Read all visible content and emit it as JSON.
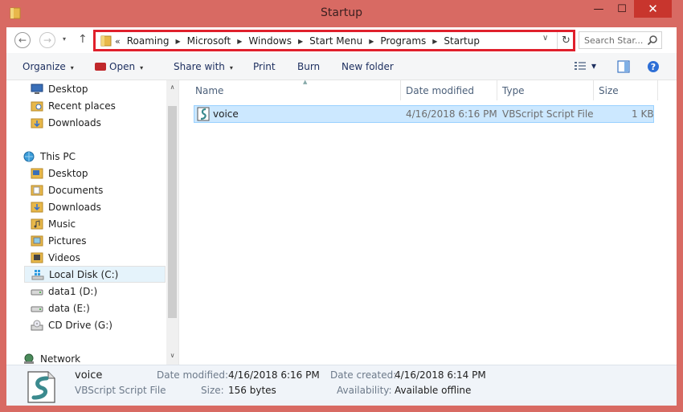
{
  "window": {
    "title": "Startup",
    "minimize": "—",
    "maximize": "☐",
    "close": "✕"
  },
  "nav": {
    "back": "←",
    "forward": "→",
    "recent": "▾",
    "up": "↑",
    "address_lead": "«",
    "breadcrumbs": [
      "Roaming",
      "Microsoft",
      "Windows",
      "Start Menu",
      "Programs",
      "Startup"
    ],
    "separator": "▶",
    "dropdown": "∨",
    "refresh": "↻",
    "search_placeholder": "Search Star..."
  },
  "toolbar": {
    "organize": "Organize",
    "open": "Open",
    "share_with": "Share with",
    "print": "Print",
    "burn": "Burn",
    "new_folder": "New folder",
    "caret": "▾"
  },
  "navpane": {
    "items": [
      {
        "label": "Desktop",
        "icon": "desktop-icon"
      },
      {
        "label": "Recent places",
        "icon": "recent-places-icon"
      },
      {
        "label": "Downloads",
        "icon": "downloads-folder-icon"
      },
      {
        "label": "This PC",
        "icon": "this-pc-icon"
      },
      {
        "label": "Desktop",
        "icon": "desktop-folder-icon"
      },
      {
        "label": "Documents",
        "icon": "documents-folder-icon"
      },
      {
        "label": "Downloads",
        "icon": "downloads-folder-icon"
      },
      {
        "label": "Music",
        "icon": "music-folder-icon"
      },
      {
        "label": "Pictures",
        "icon": "pictures-folder-icon"
      },
      {
        "label": "Videos",
        "icon": "videos-folder-icon"
      },
      {
        "label": "Local Disk (C:)",
        "icon": "windows-drive-icon"
      },
      {
        "label": "data1 (D:)",
        "icon": "drive-icon"
      },
      {
        "label": "data (E:)",
        "icon": "drive-icon"
      },
      {
        "label": "CD Drive (G:)",
        "icon": "cd-drive-icon"
      },
      {
        "label": "Network",
        "icon": "network-icon"
      }
    ],
    "scroll_up": "∧",
    "scroll_down": "∨"
  },
  "columns": {
    "name": "Name",
    "date_modified": "Date modified",
    "type": "Type",
    "size": "Size",
    "sort_indicator": "▲"
  },
  "files": [
    {
      "name": "voice",
      "date_modified": "4/16/2018 6:16 PM",
      "type": "VBScript Script File",
      "size": "1 KB"
    }
  ],
  "details": {
    "name": "voice",
    "type": "VBScript Script File",
    "date_modified_label": "Date modified:",
    "date_modified": "4/16/2018 6:16 PM",
    "size_label": "Size:",
    "size": "156 bytes",
    "date_created_label": "Date created:",
    "date_created": "4/16/2018 6:14 PM",
    "availability_label": "Availability:",
    "availability": "Available offline"
  },
  "colors": {
    "frame": "#d86a63",
    "close_button": "#c8352d",
    "address_highlight": "#e0202c",
    "selection": "#cce8ff",
    "folder": "#e8b84a"
  }
}
